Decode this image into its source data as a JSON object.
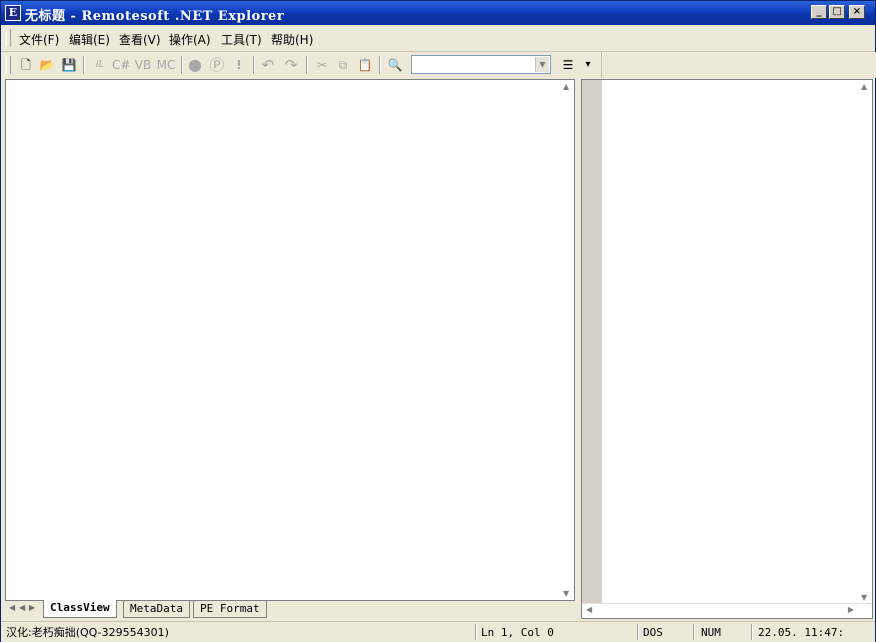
{
  "window": {
    "title": "无标题 - Remotesoft .NET Explorer",
    "icon": "app-e-icon",
    "controls": [
      "_",
      "□",
      "×"
    ]
  },
  "menu": {
    "items": [
      "文件(F)",
      "编辑(E)",
      "查看(V)",
      "操作(A)",
      "工具(T)",
      "帮助(H)"
    ]
  },
  "toolbar": {
    "buttons": {
      "new": "🗋",
      "open": "📂",
      "save": "💾",
      "il": "IL",
      "cs": "C#",
      "vb": "VB",
      "mc": "MC",
      "record": "●",
      "p": "Ⓟ",
      "bang": "!",
      "undo": "↶",
      "redo": "↷",
      "cut": "✂",
      "copy": "⧉",
      "paste": "📋",
      "find": "🔍",
      "options": "☰",
      "more": "▾"
    },
    "combo_value": ""
  },
  "tabs": [
    "ClassView",
    "MetaData",
    "PE Format"
  ],
  "active_tab": "ClassView",
  "status": {
    "credit": "汉化:老朽痴拙(QQ-329554301)",
    "position": "Ln 1, Col 0",
    "mode": "DOS",
    "num": "NUM",
    "time": "22.05. 11:47:"
  }
}
